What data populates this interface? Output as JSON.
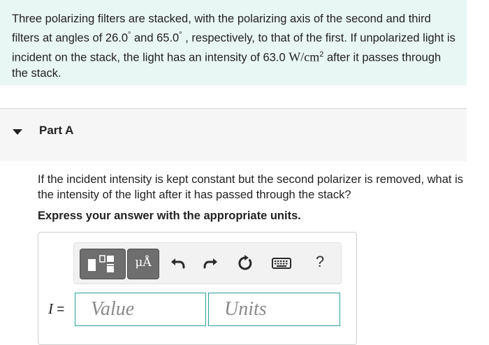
{
  "problem": {
    "text_part1": "Three polarizing filters are stacked, with the polarizing axis of the second and third filters at angles of 26.0",
    "deg": "°",
    "text_part2": " and 65.0",
    "text_part3": " , respectively, to that of the first. If unpolarized light is incident on the stack, the light has an intensity of 63.0 ",
    "unit_w": "W/cm",
    "unit_exp": "2",
    "text_part4": " after it passes through the stack."
  },
  "part": {
    "title": "Part A"
  },
  "question": "If the incident intensity is kept constant but the second polarizer is removed, what is the intensity of the light after it has passed through the stack?",
  "instruction": "Express your answer with the appropriate units.",
  "toolbar": {
    "units_label": "μÅ",
    "help_label": "?"
  },
  "answer": {
    "variable": "I",
    "equals": " =",
    "value_placeholder": "Value",
    "units_placeholder": "Units",
    "value": "",
    "units": ""
  },
  "colors": {
    "problem_bg": "#e8f6f4",
    "field_border": "#2aa198",
    "toolbar_dark": "#6e6e6e"
  },
  "icons": [
    "templates-icon",
    "units-icon",
    "undo-icon",
    "redo-icon",
    "reset-icon",
    "keyboard-icon",
    "help-icon",
    "collapse-triangle-icon"
  ]
}
